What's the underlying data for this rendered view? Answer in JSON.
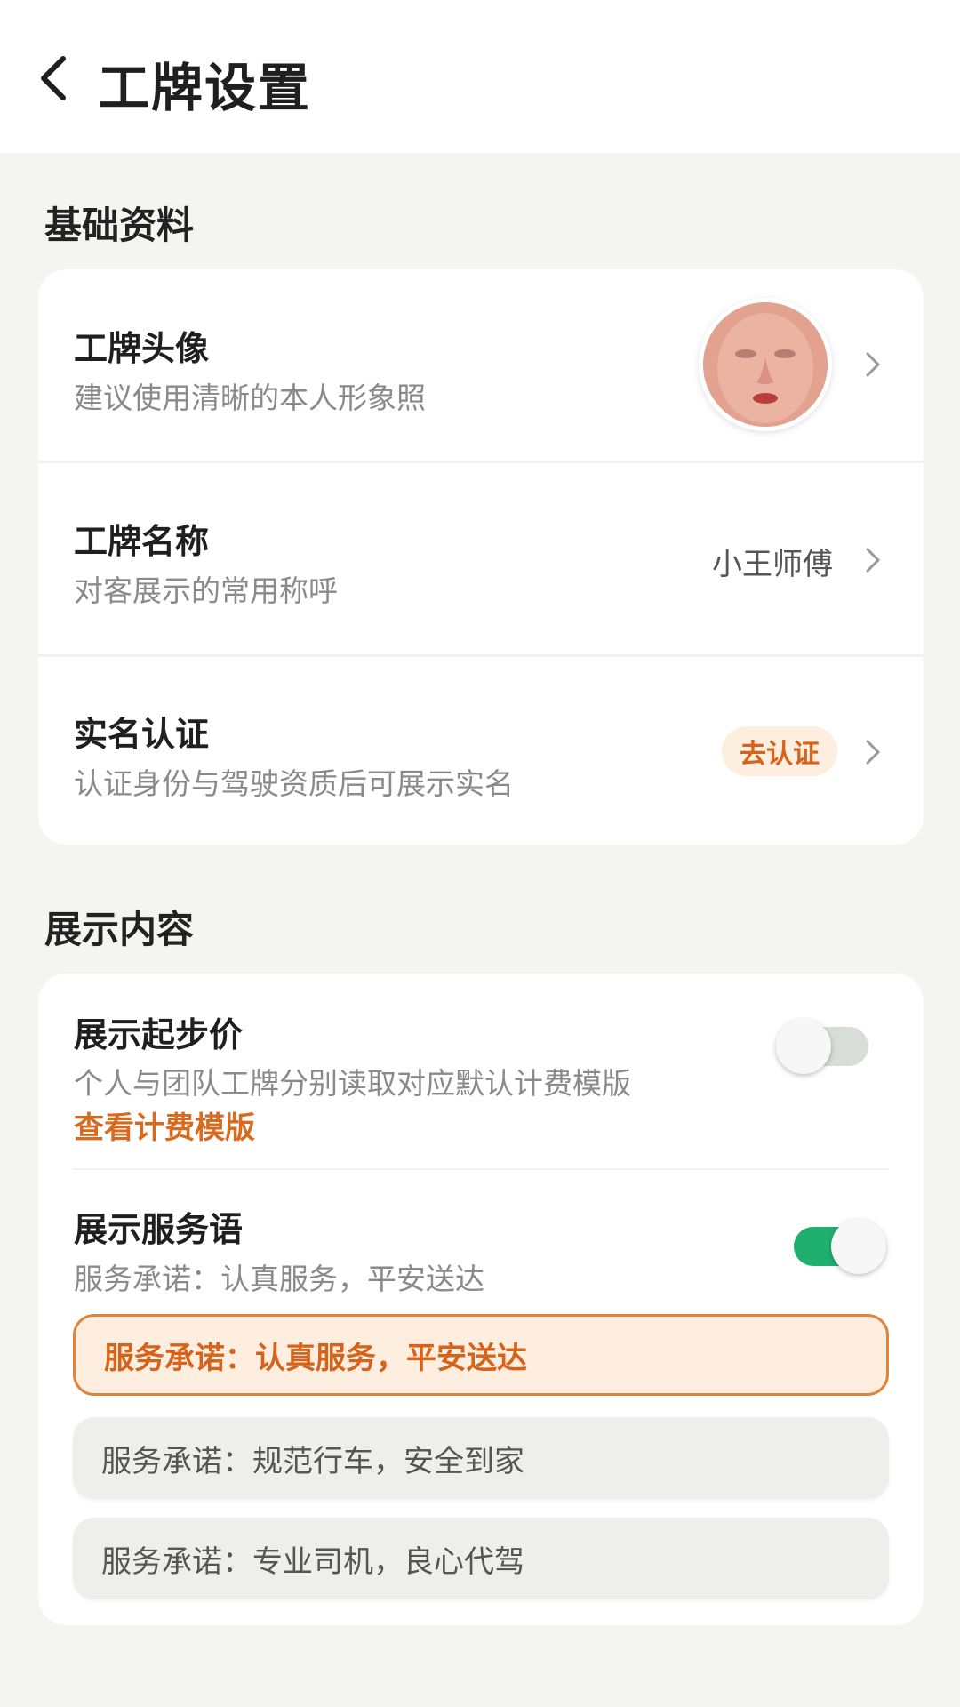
{
  "header": {
    "title": "工牌设置",
    "back_icon": "chevron-left-icon"
  },
  "basic_section": {
    "title": "基础资料",
    "rows": [
      {
        "title": "工牌头像",
        "subtitle": "建议使用清晰的本人形象照",
        "value_type": "avatar"
      },
      {
        "title": "工牌名称",
        "subtitle": "对客展示的常用称呼",
        "value": "小王师傅"
      },
      {
        "title": "实名认证",
        "subtitle": "认证身份与驾驶资质后可展示实名",
        "badge": "去认证"
      }
    ]
  },
  "display_section": {
    "title": "展示内容",
    "start_price": {
      "title": "展示起步价",
      "subtitle": "个人与团队工牌分别读取对应默认计费模版",
      "link": "查看计费模版",
      "enabled": false
    },
    "service_phrase": {
      "title": "展示服务语",
      "subtitle": "服务承诺：认真服务，平安送达",
      "enabled": true,
      "options": [
        {
          "label": "服务承诺：认真服务，平安送达",
          "selected": true
        },
        {
          "label": "服务承诺：规范行车，安全到家",
          "selected": false
        },
        {
          "label": "服务承诺：专业司机，良心代驾",
          "selected": false
        }
      ]
    }
  },
  "colors": {
    "accent": "#d7631a",
    "toggle_on": "#1fb070",
    "toggle_off": "#d9ddd8",
    "background": "#f4f4f2"
  }
}
